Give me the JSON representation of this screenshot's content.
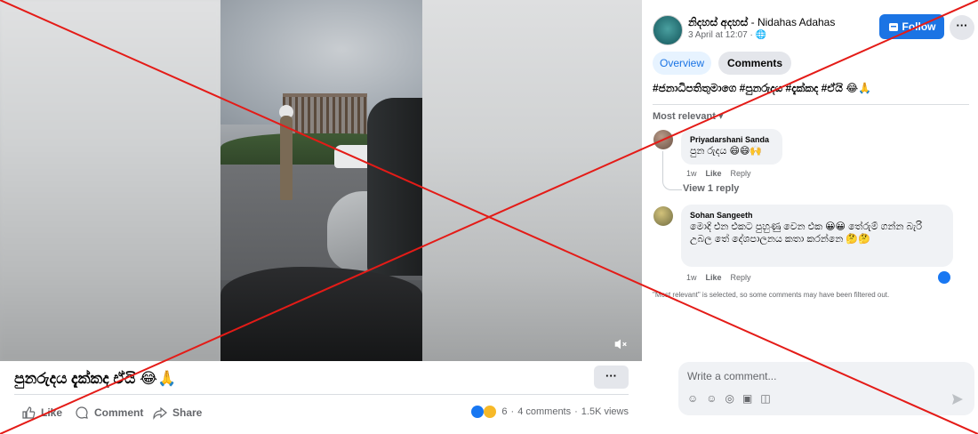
{
  "post": {
    "caption": "පුනරුදය දැක්කද ඒයි 😂🙏",
    "more_label": "···"
  },
  "actions": {
    "like_label": "Like",
    "comment_label": "Comment",
    "share_label": "Share"
  },
  "stats": {
    "reactions": "6",
    "comments": "4 comments",
    "views": "1.5K views",
    "separator": "·"
  },
  "page": {
    "name": "නිදහස් අදහස්",
    "name_suffix": " - Nidahas Adahas",
    "timestamp": "3 April at 12:07 · 🌐",
    "follow_label": "Follow",
    "more_label": "···"
  },
  "tabs": {
    "overview_label": "Overview",
    "comments_label": "Comments"
  },
  "hashtags": "#ජනාධිපතිතුමාගෙ #පුනරුදය #දැක්කද #ඒයි 😂🙏",
  "sort": {
    "label": "Most relevant ▾"
  },
  "comments": [
    {
      "author": "Priyadarshani Sanda",
      "text": "පුන රුදය 😄😄🙌",
      "age": "1w",
      "like": "Like",
      "reply": "Reply",
      "view_replies": "View 1 reply"
    },
    {
      "author": "Sohan Sangeeth",
      "text": "මොදි එන එකට පුහුණු වෙන එක 😀😀 තේරුම් ගන්න බැරි උබල තේ දේශපාලනය කතා කරන්නෙ 🤔🤔",
      "age": "1w",
      "like": "Like",
      "reply": "Reply"
    }
  ],
  "filter_note": "\"Most relevant\" is selected, so some comments may have been filtered out.",
  "composer": {
    "placeholder": "Write a comment...",
    "icons": [
      "sticker-icon",
      "emoji-icon",
      "camera-icon",
      "gif-icon",
      "avatar-sticker-icon"
    ]
  },
  "colors": {
    "brand": "#1b74e4",
    "overlay_cross": "#e41b17",
    "tab_active_bg": "#e7f3ff"
  }
}
